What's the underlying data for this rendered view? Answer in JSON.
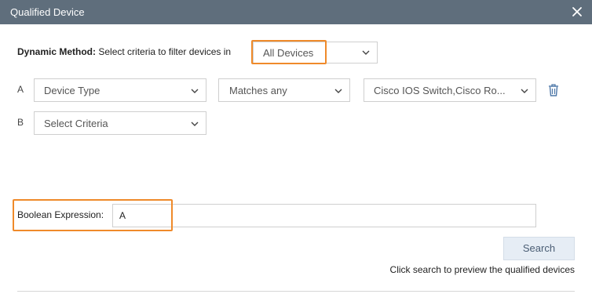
{
  "dialog": {
    "title": "Qualified Device"
  },
  "dynamic_method": {
    "label": "Dynamic Method:",
    "description": "Select criteria to filter devices in",
    "scope_value": "All Devices"
  },
  "criteria": [
    {
      "letter": "A",
      "field": "Device Type",
      "operator": "Matches any",
      "value": "Cisco IOS Switch,Cisco Ro..."
    },
    {
      "letter": "B",
      "field": "Select Criteria"
    }
  ],
  "boolean_expression": {
    "label": "Boolean Expression:",
    "value": "A"
  },
  "search": {
    "button_label": "Search",
    "hint": "Click search to preview the qualified devices"
  },
  "colors": {
    "titlebar": "#5f6e7c",
    "highlight": "#ef8a2a",
    "search_button_bg": "#e6edf5"
  },
  "icons": {
    "close": "close-icon",
    "dropdown": "chevron-down-icon",
    "delete": "trash-icon"
  }
}
